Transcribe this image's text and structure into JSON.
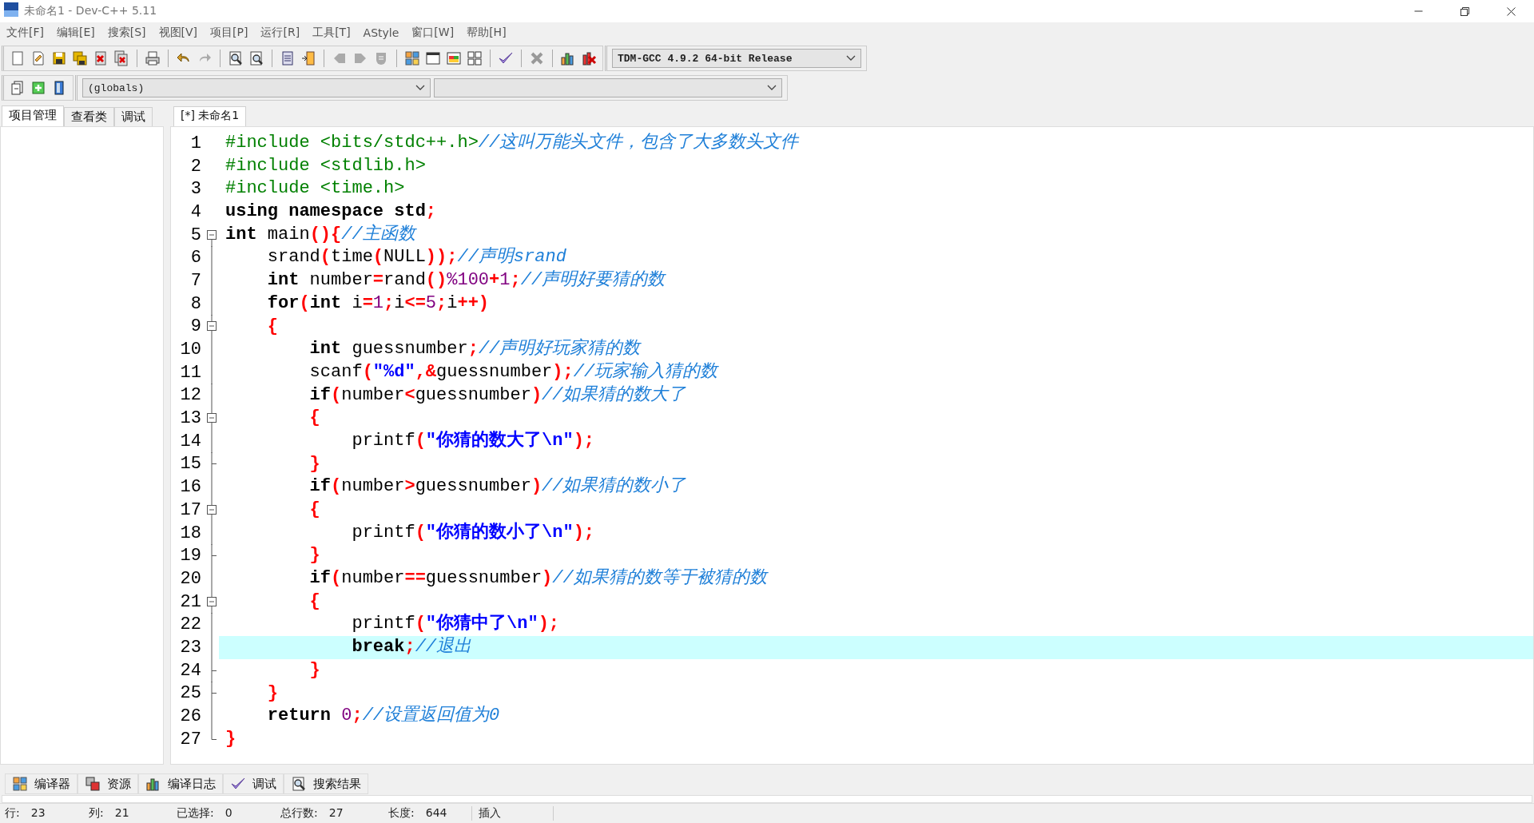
{
  "window": {
    "title": "未命名1 - Dev-C++ 5.11"
  },
  "menu": [
    "文件[F]",
    "编辑[E]",
    "搜索[S]",
    "视图[V]",
    "项目[P]",
    "运行[R]",
    "工具[T]",
    "AStyle",
    "窗口[W]",
    "帮助[H]"
  ],
  "toolbar": {
    "compiler_select": "TDM-GCC 4.9.2 64-bit Release"
  },
  "toolbar2": {
    "scope_select": "(globals)"
  },
  "left_tabs": [
    {
      "label": "项目管理",
      "selected": true
    },
    {
      "label": "查看类",
      "selected": false
    },
    {
      "label": "调试",
      "selected": false
    }
  ],
  "editor_tabs": [
    {
      "label": "[*] 未命名1",
      "selected": true
    }
  ],
  "code_lines": [
    {
      "number": "1",
      "kind": "plain",
      "current": false,
      "tokens": [
        {
          "kind": "pre",
          "text": "#include <bits/stdc++.h>"
        },
        {
          "kind": "cmt",
          "text": "//这叫万能头文件，包含了大多数头文件"
        }
      ]
    },
    {
      "number": "2",
      "kind": "plain",
      "current": false,
      "tokens": [
        {
          "kind": "pre",
          "text": "#include <stdlib.h>"
        }
      ]
    },
    {
      "number": "3",
      "kind": "plain",
      "current": false,
      "tokens": [
        {
          "kind": "pre",
          "text": "#include <time.h>"
        }
      ]
    },
    {
      "number": "4",
      "kind": "plain",
      "current": false,
      "tokens": [
        {
          "kind": "kw",
          "text": "using namespace std"
        },
        {
          "kind": "sym",
          "text": ";"
        }
      ]
    },
    {
      "number": "5",
      "kind": "start",
      "current": false,
      "tokens": [
        {
          "kind": "kw",
          "text": "int"
        },
        {
          "kind": "id",
          "text": " main"
        },
        {
          "kind": "sym",
          "text": "(){"
        },
        {
          "kind": "cmt",
          "text": "//主函数"
        }
      ]
    },
    {
      "number": "6",
      "kind": "line",
      "current": false,
      "tokens": [
        {
          "kind": "id",
          "text": "    srand"
        },
        {
          "kind": "sym",
          "text": "("
        },
        {
          "kind": "id",
          "text": "time"
        },
        {
          "kind": "sym",
          "text": "("
        },
        {
          "kind": "id",
          "text": "NULL"
        },
        {
          "kind": "sym",
          "text": "));"
        },
        {
          "kind": "cmt",
          "text": "//声明srand"
        }
      ]
    },
    {
      "number": "7",
      "kind": "line",
      "current": false,
      "tokens": [
        {
          "kind": "kw",
          "text": "    int"
        },
        {
          "kind": "id",
          "text": " number"
        },
        {
          "kind": "sym",
          "text": "="
        },
        {
          "kind": "id",
          "text": "rand"
        },
        {
          "kind": "sym",
          "text": "()"
        },
        {
          "kind": "num",
          "text": "%100"
        },
        {
          "kind": "sym",
          "text": "+"
        },
        {
          "kind": "num",
          "text": "1"
        },
        {
          "kind": "sym",
          "text": ";"
        },
        {
          "kind": "cmt",
          "text": "//声明好要猜的数"
        }
      ]
    },
    {
      "number": "8",
      "kind": "line",
      "current": false,
      "tokens": [
        {
          "kind": "kw",
          "text": "    for"
        },
        {
          "kind": "sym",
          "text": "("
        },
        {
          "kind": "kw",
          "text": "int"
        },
        {
          "kind": "id",
          "text": " i"
        },
        {
          "kind": "sym",
          "text": "="
        },
        {
          "kind": "num",
          "text": "1"
        },
        {
          "kind": "sym",
          "text": ";"
        },
        {
          "kind": "id",
          "text": "i"
        },
        {
          "kind": "sym",
          "text": "<="
        },
        {
          "kind": "num",
          "text": "5"
        },
        {
          "kind": "sym",
          "text": ";"
        },
        {
          "kind": "id",
          "text": "i"
        },
        {
          "kind": "sym",
          "text": "++)"
        }
      ]
    },
    {
      "number": "9",
      "kind": "box",
      "current": false,
      "tokens": [
        {
          "kind": "sym",
          "text": "    {"
        }
      ]
    },
    {
      "number": "10",
      "kind": "line",
      "current": false,
      "tokens": [
        {
          "kind": "kw",
          "text": "        int"
        },
        {
          "kind": "id",
          "text": " guessnumber"
        },
        {
          "kind": "sym",
          "text": ";"
        },
        {
          "kind": "cmt",
          "text": "//声明好玩家猜的数"
        }
      ]
    },
    {
      "number": "11",
      "kind": "line",
      "current": false,
      "tokens": [
        {
          "kind": "id",
          "text": "        scanf"
        },
        {
          "kind": "sym",
          "text": "("
        },
        {
          "kind": "str",
          "text": "\"%d\""
        },
        {
          "kind": "sym",
          "text": ",&"
        },
        {
          "kind": "id",
          "text": "guessnumber"
        },
        {
          "kind": "sym",
          "text": ");"
        },
        {
          "kind": "cmt",
          "text": "//玩家输入猜的数"
        }
      ]
    },
    {
      "number": "12",
      "kind": "line",
      "current": false,
      "tokens": [
        {
          "kind": "kw",
          "text": "        if"
        },
        {
          "kind": "sym",
          "text": "("
        },
        {
          "kind": "id",
          "text": "number"
        },
        {
          "kind": "sym",
          "text": "<"
        },
        {
          "kind": "id",
          "text": "guessnumber"
        },
        {
          "kind": "sym",
          "text": ")"
        },
        {
          "kind": "cmt",
          "text": "//如果猜的数大了"
        }
      ]
    },
    {
      "number": "13",
      "kind": "box",
      "current": false,
      "tokens": [
        {
          "kind": "sym",
          "text": "        {"
        }
      ]
    },
    {
      "number": "14",
      "kind": "line",
      "current": false,
      "tokens": [
        {
          "kind": "id",
          "text": "            printf"
        },
        {
          "kind": "sym",
          "text": "("
        },
        {
          "kind": "str",
          "text": "\"你猜的数大了\\n\""
        },
        {
          "kind": "sym",
          "text": ");"
        }
      ]
    },
    {
      "number": "15",
      "kind": "tick",
      "current": false,
      "tokens": [
        {
          "kind": "sym",
          "text": "        }"
        }
      ]
    },
    {
      "number": "16",
      "kind": "line",
      "current": false,
      "tokens": [
        {
          "kind": "kw",
          "text": "        if"
        },
        {
          "kind": "sym",
          "text": "("
        },
        {
          "kind": "id",
          "text": "number"
        },
        {
          "kind": "sym",
          "text": ">"
        },
        {
          "kind": "id",
          "text": "guessnumber"
        },
        {
          "kind": "sym",
          "text": ")"
        },
        {
          "kind": "cmt",
          "text": "//如果猜的数小了"
        }
      ]
    },
    {
      "number": "17",
      "kind": "box",
      "current": false,
      "tokens": [
        {
          "kind": "sym",
          "text": "        {"
        }
      ]
    },
    {
      "number": "18",
      "kind": "line",
      "current": false,
      "tokens": [
        {
          "kind": "id",
          "text": "            printf"
        },
        {
          "kind": "sym",
          "text": "("
        },
        {
          "kind": "str",
          "text": "\"你猜的数小了\\n\""
        },
        {
          "kind": "sym",
          "text": ");"
        }
      ]
    },
    {
      "number": "19",
      "kind": "tick",
      "current": false,
      "tokens": [
        {
          "kind": "sym",
          "text": "        }"
        }
      ]
    },
    {
      "number": "20",
      "kind": "line",
      "current": false,
      "tokens": [
        {
          "kind": "kw",
          "text": "        if"
        },
        {
          "kind": "sym",
          "text": "("
        },
        {
          "kind": "id",
          "text": "number"
        },
        {
          "kind": "sym",
          "text": "=="
        },
        {
          "kind": "id",
          "text": "guessnumber"
        },
        {
          "kind": "sym",
          "text": ")"
        },
        {
          "kind": "cmt",
          "text": "//如果猜的数等于被猜的数"
        }
      ]
    },
    {
      "number": "21",
      "kind": "box",
      "current": false,
      "tokens": [
        {
          "kind": "sym",
          "text": "        {"
        }
      ]
    },
    {
      "number": "22",
      "kind": "line",
      "current": false,
      "tokens": [
        {
          "kind": "id",
          "text": "            printf"
        },
        {
          "kind": "sym",
          "text": "("
        },
        {
          "kind": "str",
          "text": "\"你猜中了\\n\""
        },
        {
          "kind": "sym",
          "text": ");"
        }
      ]
    },
    {
      "number": "23",
      "kind": "line",
      "current": true,
      "tokens": [
        {
          "kind": "kw",
          "text": "            break"
        },
        {
          "kind": "sym",
          "text": ";"
        },
        {
          "kind": "cmt",
          "text": "//退出"
        }
      ]
    },
    {
      "number": "24",
      "kind": "tick",
      "current": false,
      "tokens": [
        {
          "kind": "sym",
          "text": "        }"
        }
      ]
    },
    {
      "number": "25",
      "kind": "tick",
      "current": false,
      "tokens": [
        {
          "kind": "sym",
          "text": "    }"
        }
      ]
    },
    {
      "number": "26",
      "kind": "line",
      "current": false,
      "tokens": [
        {
          "kind": "kw",
          "text": "    return"
        },
        {
          "kind": "num",
          "text": " 0"
        },
        {
          "kind": "sym",
          "text": ";"
        },
        {
          "kind": "cmt",
          "text": "//设置返回值为0"
        }
      ]
    },
    {
      "number": "27",
      "kind": "end",
      "current": false,
      "tokens": [
        {
          "kind": "sym",
          "text": "}"
        }
      ]
    }
  ],
  "bottom_tabs": [
    {
      "label": "编译器"
    },
    {
      "label": "资源"
    },
    {
      "label": "编译日志"
    },
    {
      "label": "调试"
    },
    {
      "label": "搜索结果"
    }
  ],
  "status_bar": {
    "fields": [
      {
        "label": "行:",
        "value": "23"
      },
      {
        "label": "列:",
        "value": "21"
      },
      {
        "label": "已选择:",
        "value": "0"
      },
      {
        "label": "总行数:",
        "value": "27"
      },
      {
        "label": "长度:",
        "value": "644"
      }
    ],
    "mode": "插入"
  }
}
